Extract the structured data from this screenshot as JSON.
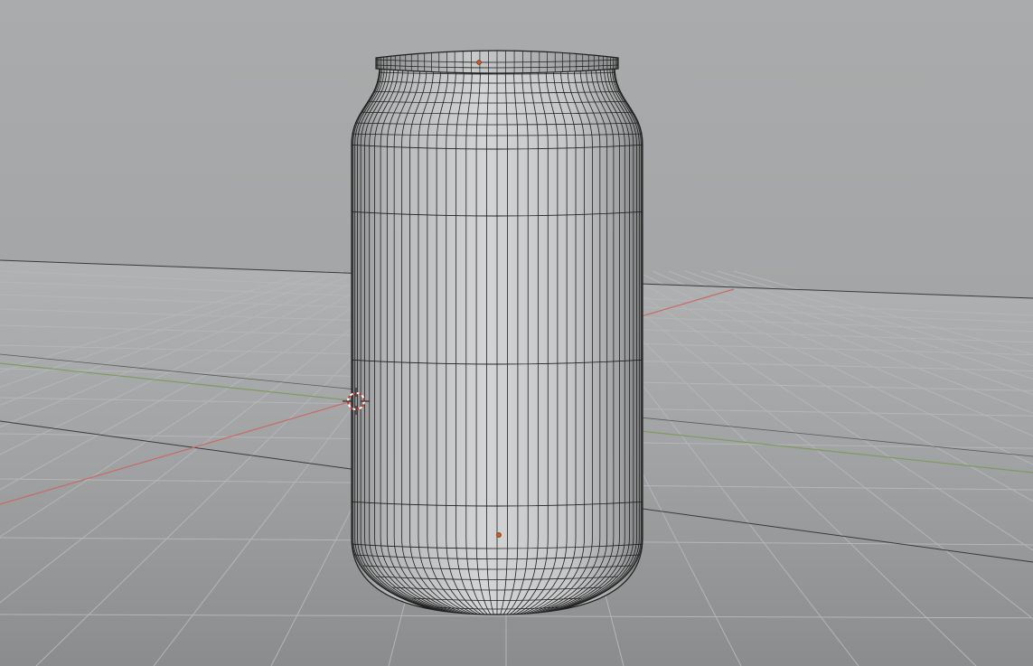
{
  "viewport": {
    "mode": "3D viewport",
    "shading": "solid",
    "overlay": "wireframe",
    "axes": {
      "x_color": "#c96a6a",
      "y_color": "#7f9a5f"
    }
  },
  "object": {
    "kind": "can-mesh",
    "origin_color": "#d4561e"
  },
  "cursor": {
    "name": "3d-cursor"
  },
  "colors": {
    "background_top": "#a9abac",
    "background_bottom": "#8f9091",
    "floor": "#a5a7a8",
    "grid_minor": "#b4b6b7",
    "grid_major": "#3a3a3a",
    "mesh_fill": "#bfc0c1",
    "mesh_wire": "#1f1f1f"
  }
}
